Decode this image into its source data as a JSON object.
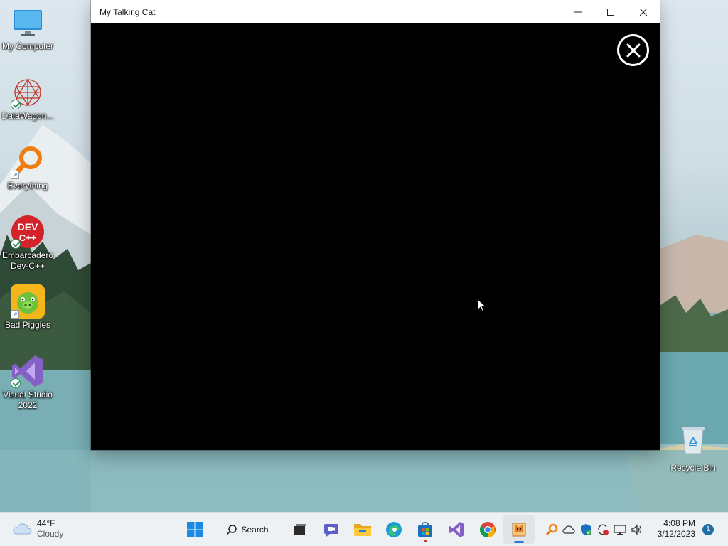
{
  "window": {
    "title": "My Talking Cat",
    "minimize_icon": "minimize-icon",
    "maximize_icon": "maximize-icon",
    "close_icon": "close-icon",
    "content_close_icon": "circle-close-icon"
  },
  "desktop": {
    "icons": [
      {
        "label": "My Computer",
        "icon": "monitor-icon"
      },
      {
        "label": "DataWagon...",
        "icon": "datawagon-icon"
      },
      {
        "label": "Everything",
        "icon": "magnifier-icon"
      },
      {
        "label": "Embarcadero Dev-C++",
        "icon": "devcpp-icon"
      },
      {
        "label": "Bad Piggies",
        "icon": "pig-icon"
      },
      {
        "label": "Visual Studio 2022",
        "icon": "visual-studio-icon"
      }
    ],
    "recycle_bin": {
      "label": "Recycle Bin",
      "icon": "recycle-bin-icon"
    }
  },
  "taskbar": {
    "weather": {
      "temp": "44°F",
      "condition": "Cloudy",
      "icon": "cloud-icon"
    },
    "search_label": "Search",
    "apps": [
      {
        "name": "start",
        "icon": "windows-start-icon"
      },
      {
        "name": "search",
        "icon": "search-icon"
      },
      {
        "name": "task-view",
        "icon": "task-view-icon"
      },
      {
        "name": "chat",
        "icon": "teams-chat-icon"
      },
      {
        "name": "file-explorer",
        "icon": "folder-icon"
      },
      {
        "name": "edge",
        "icon": "edge-icon"
      },
      {
        "name": "store",
        "icon": "store-icon"
      },
      {
        "name": "visual-studio",
        "icon": "visual-studio-icon"
      },
      {
        "name": "chrome",
        "icon": "chrome-icon"
      },
      {
        "name": "my-talking-cat",
        "icon": "cat-app-icon"
      }
    ],
    "tray": [
      "magnifier-icon",
      "onedrive-icon",
      "security-icon",
      "sync-icon",
      "network-icon",
      "volume-icon"
    ],
    "clock": {
      "time": "4:08 PM",
      "date": "3/12/2023"
    },
    "notification_count": "1"
  },
  "colors": {
    "window_content": "#000000",
    "titlebar": "#ffffff",
    "taskbar": "#eef1f4",
    "accent": "#2a7bd5"
  }
}
